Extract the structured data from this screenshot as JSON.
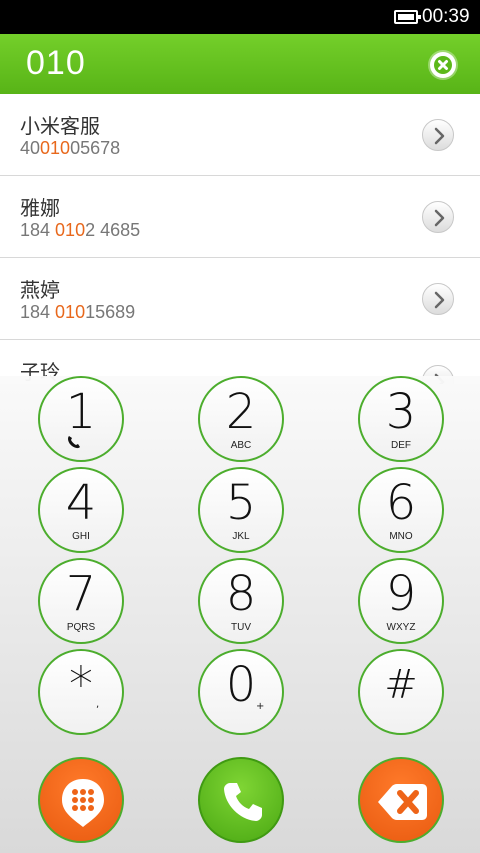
{
  "status_bar": {
    "time": "00:39",
    "battery_icon": "battery-full-icon"
  },
  "header": {
    "dialed_number": "010",
    "clear_icon": "clear-circle-icon"
  },
  "contacts": [
    {
      "name": "小米客服",
      "phone_before": "40",
      "phone_match": "010",
      "phone_after": "05678"
    },
    {
      "name": "雅娜",
      "phone_before": "184 ",
      "phone_match": "010",
      "phone_after": "2 4685"
    },
    {
      "name": "燕婷",
      "phone_before": "184 ",
      "phone_match": "010",
      "phone_after": "15689"
    },
    {
      "name": "子玲",
      "phone_before": "",
      "phone_match": "",
      "phone_after": ""
    }
  ],
  "keypad": {
    "keys": [
      {
        "digit": "1",
        "letters": ""
      },
      {
        "digit": "2",
        "letters": "ABC"
      },
      {
        "digit": "3",
        "letters": "DEF"
      },
      {
        "digit": "4",
        "letters": "GHI"
      },
      {
        "digit": "5",
        "letters": "JKL"
      },
      {
        "digit": "6",
        "letters": "MNO"
      },
      {
        "digit": "7",
        "letters": "PQRS"
      },
      {
        "digit": "8",
        "letters": "TUV"
      },
      {
        "digit": "9",
        "letters": "WXYZ"
      },
      {
        "digit": "*",
        "letters": ","
      },
      {
        "digit": "0",
        "letters": "+"
      },
      {
        "digit": "#",
        "letters": ""
      }
    ]
  },
  "actions": {
    "keypad_toggle_icon": "keypad-dots-icon",
    "call_icon": "phone-handset-icon",
    "backspace_icon": "backspace-icon"
  },
  "colors": {
    "header_green": "#5cb81a",
    "key_border": "#4cad2d",
    "match_highlight": "#e8681c",
    "action_orange": "#ee6418",
    "call_green": "#5bb91f"
  }
}
